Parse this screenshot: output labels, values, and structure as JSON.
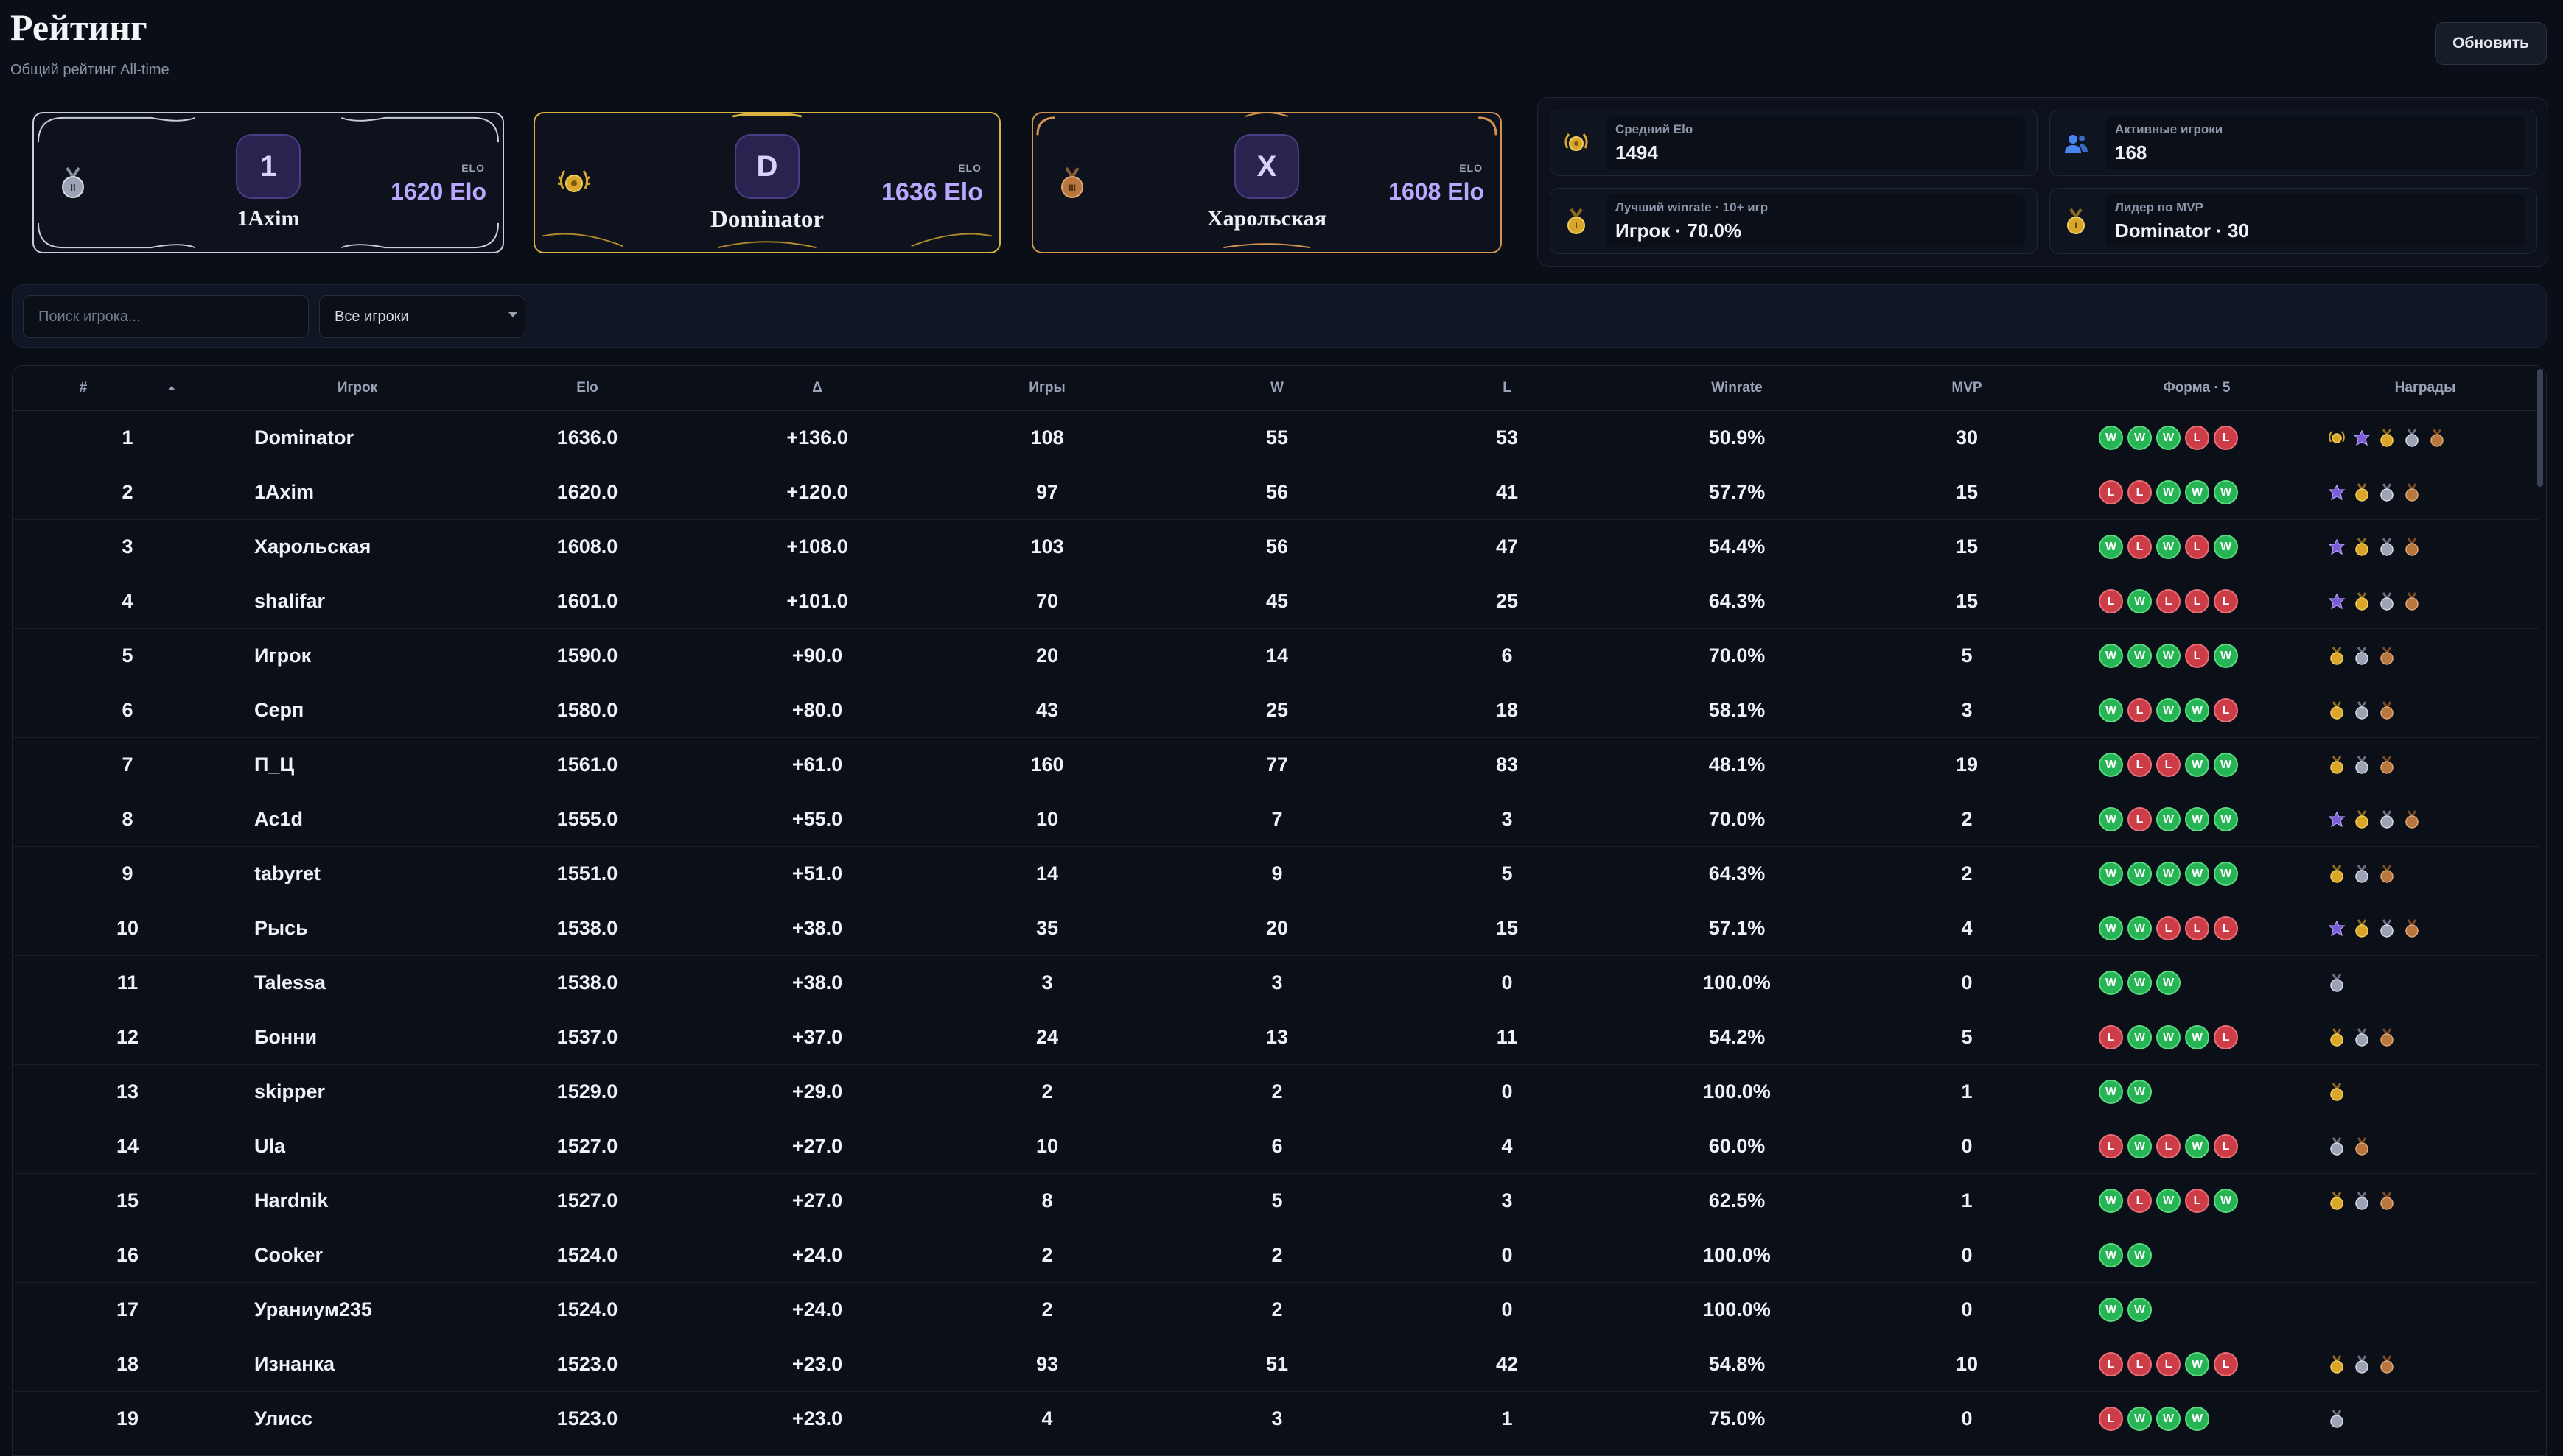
{
  "header": {
    "title": "Рейтинг",
    "subtitle": "Общий рейтинг All-time",
    "refresh_label": "Обновить"
  },
  "podium": [
    {
      "place": 2,
      "initial": "1",
      "name": "1Axim",
      "elo_label": "ELO",
      "elo": "1620 Elo",
      "medal": "silver-medal-icon",
      "accent": "#c9cde0",
      "elo_color": "#b9a8ff"
    },
    {
      "place": 1,
      "initial": "D",
      "name": "Dominator",
      "elo_label": "ELO",
      "elo": "1636 Elo",
      "medal": "gold-laurel-icon",
      "accent": "#d9b242",
      "elo_color": "#b9a8ff"
    },
    {
      "place": 3,
      "initial": "X",
      "name": "Харольская",
      "elo_label": "ELO",
      "elo": "1608 Elo",
      "medal": "bronze-medal-icon",
      "accent": "#d4934f",
      "elo_color": "#b9a8ff"
    }
  ],
  "stats": [
    {
      "label": "Средний Elo",
      "value": "1494",
      "icon": "gold-laurel-icon"
    },
    {
      "label": "Активные игроки",
      "value": "168",
      "icon": "users-icon"
    },
    {
      "label": "Лучший winrate · 10+ игр",
      "value": "Игрок · 70.0%",
      "icon": "gold-medal-icon"
    },
    {
      "label": "Лидер по MVP",
      "value": "Dominator · 30",
      "icon": "gold-medal-icon"
    }
  ],
  "filters": {
    "search_placeholder": "Поиск игрока...",
    "search_value": "",
    "select_value": "Все игроки"
  },
  "table": {
    "columns": [
      "#",
      "Игрок",
      "Elo",
      "Δ",
      "Игры",
      "W",
      "L",
      "Winrate",
      "MVP",
      "Форма · 5",
      "Награды"
    ],
    "rows": [
      {
        "rank": "1",
        "name": "Dominator",
        "elo": "1636.0",
        "delta": "+136.0",
        "games": "108",
        "w": "55",
        "l": "53",
        "winrate": "50.9%",
        "mvp": "30",
        "form": [
          "W",
          "W",
          "W",
          "L",
          "L"
        ],
        "awards": [
          "laurel",
          "purple",
          "gold",
          "silver",
          "bronze"
        ]
      },
      {
        "rank": "2",
        "name": "1Axim",
        "elo": "1620.0",
        "delta": "+120.0",
        "games": "97",
        "w": "56",
        "l": "41",
        "winrate": "57.7%",
        "mvp": "15",
        "form": [
          "L",
          "L",
          "W",
          "W",
          "W"
        ],
        "awards": [
          "purple",
          "gold",
          "silver",
          "bronze"
        ]
      },
      {
        "rank": "3",
        "name": "Харольская",
        "elo": "1608.0",
        "delta": "+108.0",
        "games": "103",
        "w": "56",
        "l": "47",
        "winrate": "54.4%",
        "mvp": "15",
        "form": [
          "W",
          "L",
          "W",
          "L",
          "W"
        ],
        "awards": [
          "purple",
          "gold",
          "silver",
          "bronze"
        ]
      },
      {
        "rank": "4",
        "name": "shalifar",
        "elo": "1601.0",
        "delta": "+101.0",
        "games": "70",
        "w": "45",
        "l": "25",
        "winrate": "64.3%",
        "mvp": "15",
        "form": [
          "L",
          "W",
          "L",
          "L",
          "L"
        ],
        "awards": [
          "purple",
          "gold",
          "silver",
          "bronze"
        ]
      },
      {
        "rank": "5",
        "name": "Игрок",
        "elo": "1590.0",
        "delta": "+90.0",
        "games": "20",
        "w": "14",
        "l": "6",
        "winrate": "70.0%",
        "mvp": "5",
        "form": [
          "W",
          "W",
          "W",
          "L",
          "W"
        ],
        "awards": [
          "gold",
          "silver",
          "bronze"
        ]
      },
      {
        "rank": "6",
        "name": "Серп",
        "elo": "1580.0",
        "delta": "+80.0",
        "games": "43",
        "w": "25",
        "l": "18",
        "winrate": "58.1%",
        "mvp": "3",
        "form": [
          "W",
          "L",
          "W",
          "W",
          "L"
        ],
        "awards": [
          "gold",
          "silver",
          "bronze"
        ]
      },
      {
        "rank": "7",
        "name": "П_Ц",
        "elo": "1561.0",
        "delta": "+61.0",
        "games": "160",
        "w": "77",
        "l": "83",
        "winrate": "48.1%",
        "mvp": "19",
        "form": [
          "W",
          "L",
          "L",
          "W",
          "W"
        ],
        "awards": [
          "gold",
          "silver",
          "bronze"
        ]
      },
      {
        "rank": "8",
        "name": "Ac1d",
        "elo": "1555.0",
        "delta": "+55.0",
        "games": "10",
        "w": "7",
        "l": "3",
        "winrate": "70.0%",
        "mvp": "2",
        "form": [
          "W",
          "L",
          "W",
          "W",
          "W"
        ],
        "awards": [
          "purple",
          "gold",
          "silver",
          "bronze"
        ]
      },
      {
        "rank": "9",
        "name": "tabyret",
        "elo": "1551.0",
        "delta": "+51.0",
        "games": "14",
        "w": "9",
        "l": "5",
        "winrate": "64.3%",
        "mvp": "2",
        "form": [
          "W",
          "W",
          "W",
          "W",
          "W"
        ],
        "awards": [
          "gold",
          "silver",
          "bronze"
        ]
      },
      {
        "rank": "10",
        "name": "Рысь",
        "elo": "1538.0",
        "delta": "+38.0",
        "games": "35",
        "w": "20",
        "l": "15",
        "winrate": "57.1%",
        "mvp": "4",
        "form": [
          "W",
          "W",
          "L",
          "L",
          "L"
        ],
        "awards": [
          "purple",
          "gold",
          "silver",
          "bronze"
        ]
      },
      {
        "rank": "11",
        "name": "Talessa",
        "elo": "1538.0",
        "delta": "+38.0",
        "games": "3",
        "w": "3",
        "l": "0",
        "winrate": "100.0%",
        "mvp": "0",
        "form": [
          "W",
          "W",
          "W"
        ],
        "awards": [
          "silver"
        ]
      },
      {
        "rank": "12",
        "name": "Бонни",
        "elo": "1537.0",
        "delta": "+37.0",
        "games": "24",
        "w": "13",
        "l": "11",
        "winrate": "54.2%",
        "mvp": "5",
        "form": [
          "L",
          "W",
          "W",
          "W",
          "L"
        ],
        "awards": [
          "gold",
          "silver",
          "bronze"
        ]
      },
      {
        "rank": "13",
        "name": "skipper",
        "elo": "1529.0",
        "delta": "+29.0",
        "games": "2",
        "w": "2",
        "l": "0",
        "winrate": "100.0%",
        "mvp": "1",
        "form": [
          "W",
          "W"
        ],
        "awards": [
          "gold"
        ]
      },
      {
        "rank": "14",
        "name": "Ula",
        "elo": "1527.0",
        "delta": "+27.0",
        "games": "10",
        "w": "6",
        "l": "4",
        "winrate": "60.0%",
        "mvp": "0",
        "form": [
          "L",
          "W",
          "L",
          "W",
          "L"
        ],
        "awards": [
          "silver",
          "bronze"
        ]
      },
      {
        "rank": "15",
        "name": "Hardnik",
        "elo": "1527.0",
        "delta": "+27.0",
        "games": "8",
        "w": "5",
        "l": "3",
        "winrate": "62.5%",
        "mvp": "1",
        "form": [
          "W",
          "L",
          "W",
          "L",
          "W"
        ],
        "awards": [
          "gold",
          "silver",
          "bronze"
        ]
      },
      {
        "rank": "16",
        "name": "Cooker",
        "elo": "1524.0",
        "delta": "+24.0",
        "games": "2",
        "w": "2",
        "l": "0",
        "winrate": "100.0%",
        "mvp": "0",
        "form": [
          "W",
          "W"
        ],
        "awards": []
      },
      {
        "rank": "17",
        "name": "Ураниум235",
        "elo": "1524.0",
        "delta": "+24.0",
        "games": "2",
        "w": "2",
        "l": "0",
        "winrate": "100.0%",
        "mvp": "0",
        "form": [
          "W",
          "W"
        ],
        "awards": []
      },
      {
        "rank": "18",
        "name": "Изнанка",
        "elo": "1523.0",
        "delta": "+23.0",
        "games": "93",
        "w": "51",
        "l": "42",
        "winrate": "54.8%",
        "mvp": "10",
        "form": [
          "L",
          "L",
          "L",
          "W",
          "L"
        ],
        "awards": [
          "gold",
          "silver",
          "bronze"
        ]
      },
      {
        "rank": "19",
        "name": "Улисс",
        "elo": "1523.0",
        "delta": "+23.0",
        "games": "4",
        "w": "3",
        "l": "1",
        "winrate": "75.0%",
        "mvp": "0",
        "form": [
          "L",
          "W",
          "W",
          "W"
        ],
        "awards": [
          "silver"
        ]
      }
    ]
  },
  "colors": {
    "background": "#0a0e17",
    "win": "#26b454",
    "loss": "#cd3d48",
    "elo_accent": "#b9a8ff"
  }
}
